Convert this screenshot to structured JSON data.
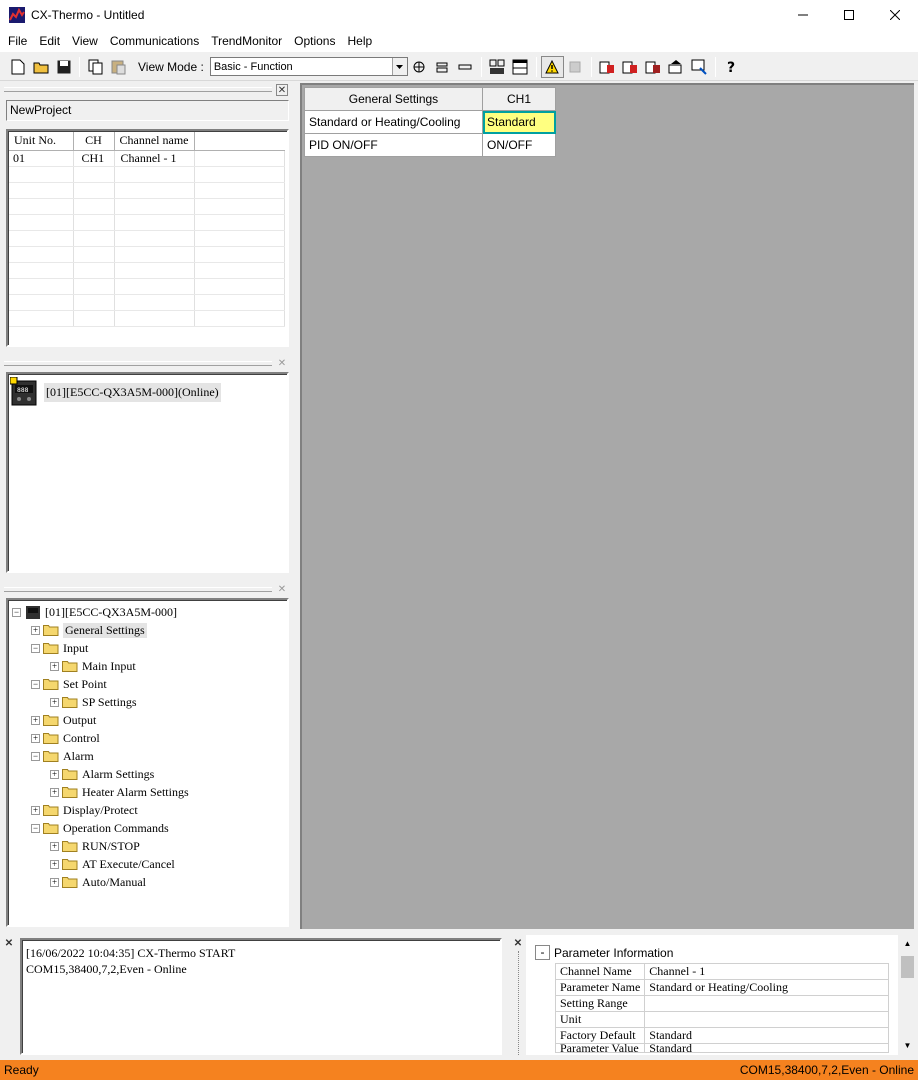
{
  "window": {
    "title": "CX-Thermo - Untitled"
  },
  "menu": [
    "File",
    "Edit",
    "View",
    "Communications",
    "TrendMonitor",
    "Options",
    "Help"
  ],
  "toolbar": {
    "view_mode_label": "View Mode :",
    "view_mode_value": "Basic - Function"
  },
  "project": {
    "name": "NewProject"
  },
  "unit_table": {
    "headers": [
      "Unit No.",
      "CH",
      "Channel name"
    ],
    "rows": [
      [
        "01",
        "CH1",
        "Channel - 1"
      ]
    ]
  },
  "device_panel": {
    "device_label": "[01][E5CC-QX3A5M-000](Online)"
  },
  "tree": {
    "root": "[01][E5CC-QX3A5M-000]",
    "items": [
      "General Settings",
      "Input",
      "Main Input",
      "Set Point",
      "SP Settings",
      "Output",
      "Control",
      "Alarm",
      "Alarm Settings",
      "Heater Alarm Settings",
      "Display/Protect",
      "Operation Commands",
      "RUN/STOP",
      "AT Execute/Cancel",
      "Auto/Manual"
    ]
  },
  "param_grid": {
    "header_col": "General Settings",
    "channel": "CH1",
    "rows": [
      {
        "name": "Standard or Heating/Cooling",
        "value": "Standard"
      },
      {
        "name": "PID ON/OFF",
        "value": "ON/OFF"
      }
    ]
  },
  "log": {
    "lines": [
      "[16/06/2022 10:04:35] CX-Thermo START",
      "COM15,38400,7,2,Even - Online"
    ]
  },
  "param_info": {
    "title": "Parameter Information",
    "rows": [
      {
        "label": "Channel Name",
        "value": "Channel - 1"
      },
      {
        "label": "Parameter Name",
        "value": "Standard or Heating/Cooling"
      },
      {
        "label": "Setting Range",
        "value": ""
      },
      {
        "label": "Unit",
        "value": ""
      },
      {
        "label": "Factory Default",
        "value": "Standard"
      },
      {
        "label": "Parameter Value",
        "value": "Standard"
      }
    ]
  },
  "status": {
    "left": "Ready",
    "right": "COM15,38400,7,2,Even - Online"
  },
  "colors": {
    "status_bar": "#f5821f",
    "selected_cell": "#ffff80",
    "grid_bg": "#a8a8a8"
  }
}
